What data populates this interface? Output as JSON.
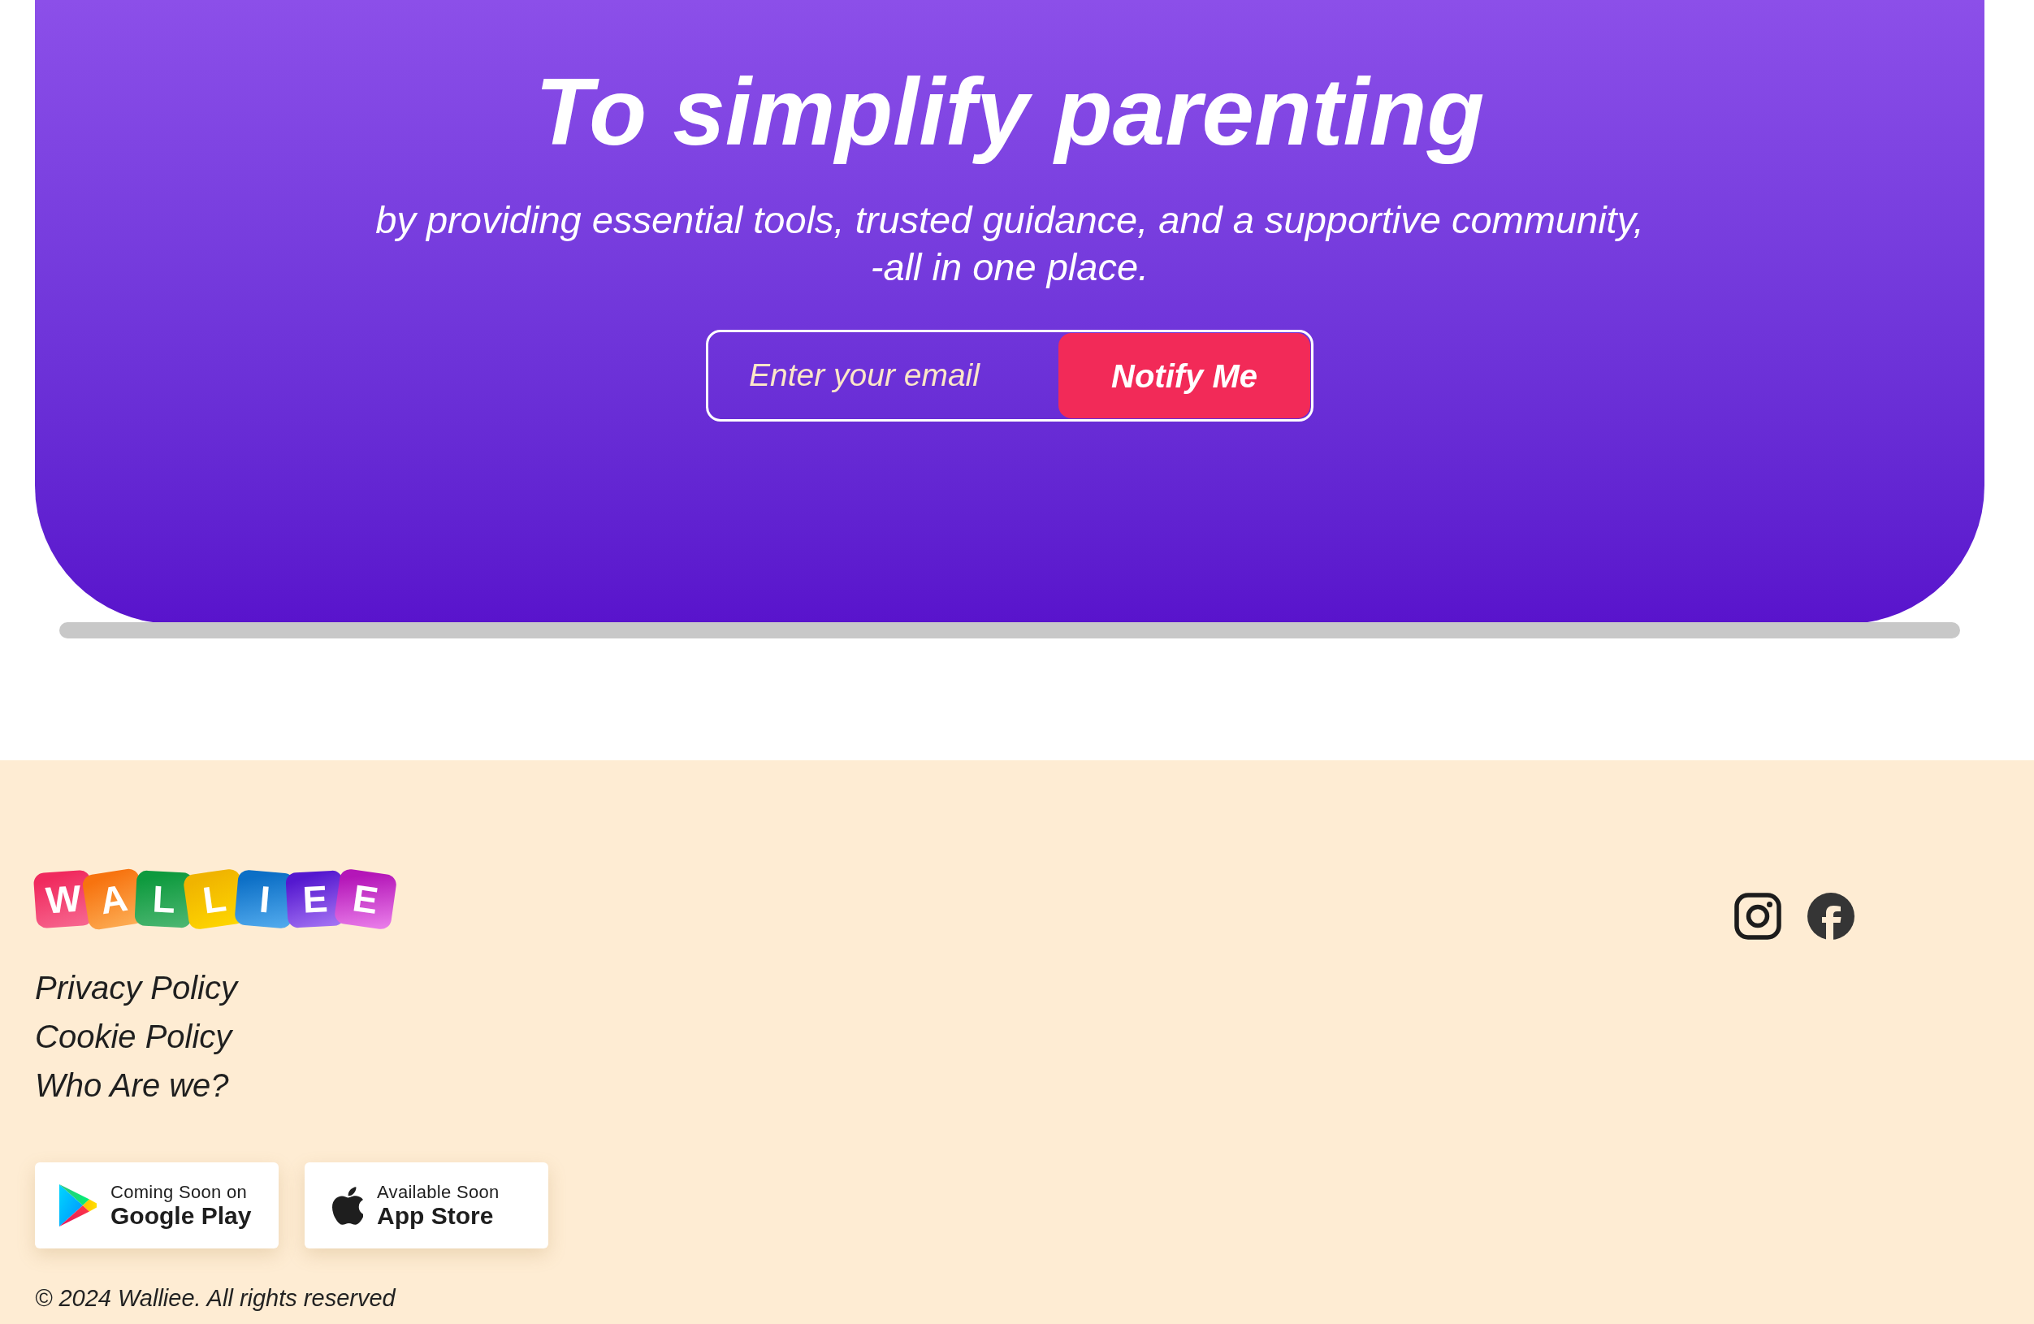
{
  "hero": {
    "title": "To simplify parenting",
    "subtitle_lines": [
      "by providing essential tools, trusted guidance, and a supportive community,",
      "-all in one place."
    ],
    "signup": {
      "email_field": {
        "placeholder": "Enter your email"
      },
      "button": "Notify Me"
    }
  },
  "footer": {
    "logo": {
      "letters": [
        "W",
        "A",
        "L",
        "L",
        "I",
        "E",
        "E"
      ]
    },
    "links": [
      "Privacy Policy",
      "Cookie Policy",
      "Who Are we?"
    ],
    "store_badges": [
      {
        "kind": "google_play",
        "caption": "Coming Soon on",
        "store": "Google Play"
      },
      {
        "kind": "app_store",
        "caption": "Available Soon",
        "store": "App Store"
      }
    ],
    "copyright": "© 2024 Walliee. All rights reserved"
  }
}
